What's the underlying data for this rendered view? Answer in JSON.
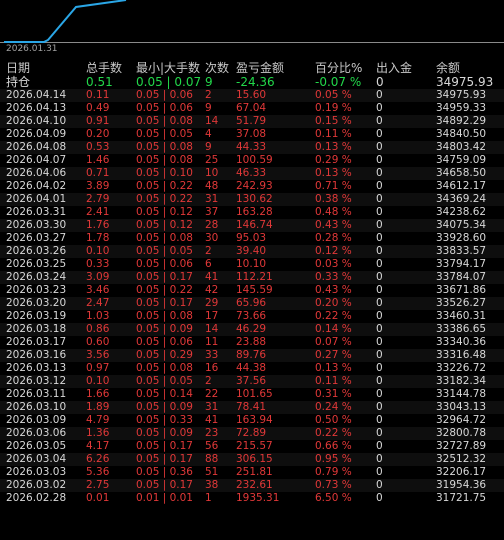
{
  "chart": {
    "date_label": "2026.01.31",
    "line_color": "#2aa6e6",
    "axis_color": "#8a8a8a"
  },
  "headers": {
    "date": "日期",
    "lots": "总手数",
    "minmax": "最小|大手数",
    "count": "次数",
    "pnl": "盈亏金额",
    "pct": "百分比%",
    "io": "出入金",
    "balance": "余额"
  },
  "holding": {
    "label": "持仓",
    "lots": "0.51",
    "minmax": "0.05 | 0.07",
    "count": "9",
    "pnl": "-24.36",
    "pct": "-0.07 %",
    "io": "0",
    "balance": "34975.93"
  },
  "rows": [
    {
      "date": "2026.04.14",
      "lots": "0.11",
      "minmax": "0.05 | 0.06",
      "count": "2",
      "pnl": "15.60",
      "pct": "0.05 %",
      "io": "0",
      "balance": "34975.93"
    },
    {
      "date": "2026.04.13",
      "lots": "0.49",
      "minmax": "0.05 | 0.06",
      "count": "9",
      "pnl": "67.04",
      "pct": "0.19 %",
      "io": "0",
      "balance": "34959.33"
    },
    {
      "date": "2026.04.10",
      "lots": "0.91",
      "minmax": "0.05 | 0.08",
      "count": "14",
      "pnl": "51.79",
      "pct": "0.15 %",
      "io": "0",
      "balance": "34892.29"
    },
    {
      "date": "2026.04.09",
      "lots": "0.20",
      "minmax": "0.05 | 0.05",
      "count": "4",
      "pnl": "37.08",
      "pct": "0.11 %",
      "io": "0",
      "balance": "34840.50"
    },
    {
      "date": "2026.04.08",
      "lots": "0.53",
      "minmax": "0.05 | 0.08",
      "count": "9",
      "pnl": "44.33",
      "pct": "0.13 %",
      "io": "0",
      "balance": "34803.42"
    },
    {
      "date": "2026.04.07",
      "lots": "1.46",
      "minmax": "0.05 | 0.08",
      "count": "25",
      "pnl": "100.59",
      "pct": "0.29 %",
      "io": "0",
      "balance": "34759.09"
    },
    {
      "date": "2026.04.06",
      "lots": "0.71",
      "minmax": "0.05 | 0.10",
      "count": "10",
      "pnl": "46.33",
      "pct": "0.13 %",
      "io": "0",
      "balance": "34658.50"
    },
    {
      "date": "2026.04.02",
      "lots": "3.89",
      "minmax": "0.05 | 0.22",
      "count": "48",
      "pnl": "242.93",
      "pct": "0.71 %",
      "io": "0",
      "balance": "34612.17"
    },
    {
      "date": "2026.04.01",
      "lots": "2.79",
      "minmax": "0.05 | 0.22",
      "count": "31",
      "pnl": "130.62",
      "pct": "0.38 %",
      "io": "0",
      "balance": "34369.24"
    },
    {
      "date": "2026.03.31",
      "lots": "2.41",
      "minmax": "0.05 | 0.12",
      "count": "37",
      "pnl": "163.28",
      "pct": "0.48 %",
      "io": "0",
      "balance": "34238.62"
    },
    {
      "date": "2026.03.30",
      "lots": "1.76",
      "minmax": "0.05 | 0.12",
      "count": "28",
      "pnl": "146.74",
      "pct": "0.43 %",
      "io": "0",
      "balance": "34075.34"
    },
    {
      "date": "2026.03.27",
      "lots": "1.78",
      "minmax": "0.05 | 0.08",
      "count": "30",
      "pnl": "95.03",
      "pct": "0.28 %",
      "io": "0",
      "balance": "33928.60"
    },
    {
      "date": "2026.03.26",
      "lots": "0.10",
      "minmax": "0.05 | 0.05",
      "count": "2",
      "pnl": "39.40",
      "pct": "0.12 %",
      "io": "0",
      "balance": "33833.57"
    },
    {
      "date": "2026.03.25",
      "lots": "0.33",
      "minmax": "0.05 | 0.06",
      "count": "6",
      "pnl": "10.10",
      "pct": "0.03 %",
      "io": "0",
      "balance": "33794.17"
    },
    {
      "date": "2026.03.24",
      "lots": "3.09",
      "minmax": "0.05 | 0.17",
      "count": "41",
      "pnl": "112.21",
      "pct": "0.33 %",
      "io": "0",
      "balance": "33784.07"
    },
    {
      "date": "2026.03.23",
      "lots": "3.46",
      "minmax": "0.05 | 0.22",
      "count": "42",
      "pnl": "145.59",
      "pct": "0.43 %",
      "io": "0",
      "balance": "33671.86"
    },
    {
      "date": "2026.03.20",
      "lots": "2.47",
      "minmax": "0.05 | 0.17",
      "count": "29",
      "pnl": "65.96",
      "pct": "0.20 %",
      "io": "0",
      "balance": "33526.27"
    },
    {
      "date": "2026.03.19",
      "lots": "1.03",
      "minmax": "0.05 | 0.08",
      "count": "17",
      "pnl": "73.66",
      "pct": "0.22 %",
      "io": "0",
      "balance": "33460.31"
    },
    {
      "date": "2026.03.18",
      "lots": "0.86",
      "minmax": "0.05 | 0.09",
      "count": "14",
      "pnl": "46.29",
      "pct": "0.14 %",
      "io": "0",
      "balance": "33386.65"
    },
    {
      "date": "2026.03.17",
      "lots": "0.60",
      "minmax": "0.05 | 0.06",
      "count": "11",
      "pnl": "23.88",
      "pct": "0.07 %",
      "io": "0",
      "balance": "33340.36"
    },
    {
      "date": "2026.03.16",
      "lots": "3.56",
      "minmax": "0.05 | 0.29",
      "count": "33",
      "pnl": "89.76",
      "pct": "0.27 %",
      "io": "0",
      "balance": "33316.48"
    },
    {
      "date": "2026.03.13",
      "lots": "0.97",
      "minmax": "0.05 | 0.08",
      "count": "16",
      "pnl": "44.38",
      "pct": "0.13 %",
      "io": "0",
      "balance": "33226.72"
    },
    {
      "date": "2026.03.12",
      "lots": "0.10",
      "minmax": "0.05 | 0.05",
      "count": "2",
      "pnl": "37.56",
      "pct": "0.11 %",
      "io": "0",
      "balance": "33182.34"
    },
    {
      "date": "2026.03.11",
      "lots": "1.66",
      "minmax": "0.05 | 0.14",
      "count": "22",
      "pnl": "101.65",
      "pct": "0.31 %",
      "io": "0",
      "balance": "33144.78"
    },
    {
      "date": "2026.03.10",
      "lots": "1.89",
      "minmax": "0.05 | 0.09",
      "count": "31",
      "pnl": "78.41",
      "pct": "0.24 %",
      "io": "0",
      "balance": "33043.13"
    },
    {
      "date": "2026.03.09",
      "lots": "4.79",
      "minmax": "0.05 | 0.33",
      "count": "41",
      "pnl": "163.94",
      "pct": "0.50 %",
      "io": "0",
      "balance": "32964.72"
    },
    {
      "date": "2026.03.06",
      "lots": "1.36",
      "minmax": "0.05 | 0.09",
      "count": "23",
      "pnl": "72.89",
      "pct": "0.22 %",
      "io": "0",
      "balance": "32800.78"
    },
    {
      "date": "2026.03.05",
      "lots": "4.17",
      "minmax": "0.05 | 0.17",
      "count": "56",
      "pnl": "215.57",
      "pct": "0.66 %",
      "io": "0",
      "balance": "32727.89"
    },
    {
      "date": "2026.03.04",
      "lots": "6.26",
      "minmax": "0.05 | 0.17",
      "count": "88",
      "pnl": "306.15",
      "pct": "0.95 %",
      "io": "0",
      "balance": "32512.32"
    },
    {
      "date": "2026.03.03",
      "lots": "5.36",
      "minmax": "0.05 | 0.36",
      "count": "51",
      "pnl": "251.81",
      "pct": "0.79 %",
      "io": "0",
      "balance": "32206.17"
    },
    {
      "date": "2026.03.02",
      "lots": "2.75",
      "minmax": "0.05 | 0.17",
      "count": "38",
      "pnl": "232.61",
      "pct": "0.73 %",
      "io": "0",
      "balance": "31954.36"
    },
    {
      "date": "2026.02.28",
      "lots": "0.01",
      "minmax": "0.01 | 0.01",
      "count": "1",
      "pnl": "1935.31",
      "pct": "6.50 %",
      "io": "0",
      "balance": "31721.75"
    }
  ]
}
